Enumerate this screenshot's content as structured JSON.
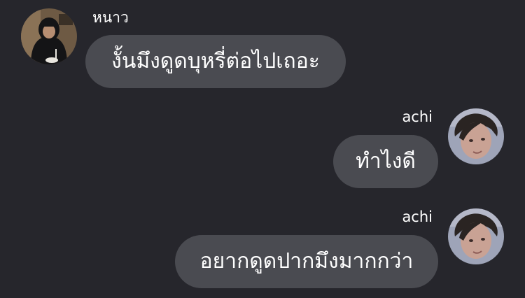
{
  "messages": [
    {
      "sender": "หนาว",
      "text": "งั้นมึงดูดบุหรี่ต่อไปเถอะ",
      "avatar_icon": "hooded-person-avatar-icon",
      "direction": "incoming"
    },
    {
      "sender": "achi",
      "text": "ทำไงดี",
      "avatar_icon": "face-photo-avatar-icon",
      "direction": "outgoing"
    },
    {
      "sender": "achi",
      "text": "อยากดูดปากมึงมากกว่า",
      "avatar_icon": "face-photo-avatar-icon",
      "direction": "outgoing"
    }
  ],
  "colors": {
    "background": "#26262c",
    "bubble": "#4a4b51",
    "text": "#ffffff"
  }
}
